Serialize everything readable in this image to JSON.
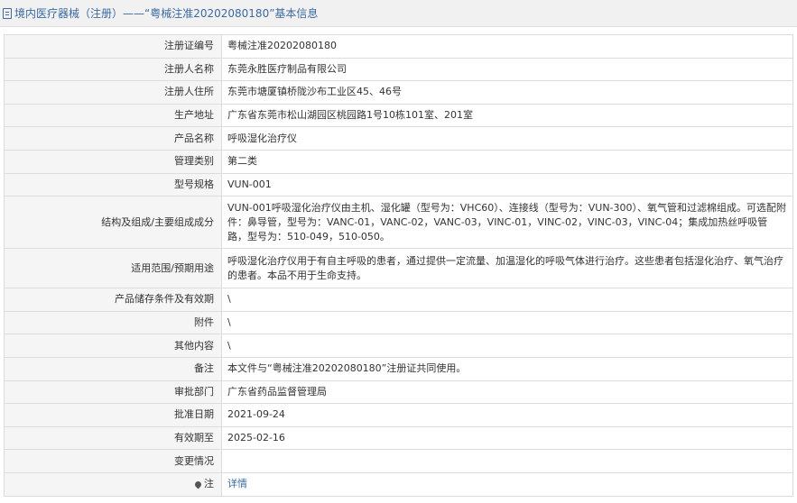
{
  "header": {
    "title": "境内医疗器械（注册）——“粤械注准20202080180”基本信息"
  },
  "rows": [
    {
      "label": "注册证编号",
      "value": "粤械注准20202080180"
    },
    {
      "label": "注册人名称",
      "value": "东莞永胜医疗制品有限公司"
    },
    {
      "label": "注册人住所",
      "value": "东莞市塘厦镇桥陇沙布工业区45、46号"
    },
    {
      "label": "生产地址",
      "value": "广东省东莞市松山湖园区桃园路1号10栋101室、201室"
    },
    {
      "label": "产品名称",
      "value": "呼吸湿化治疗仪"
    },
    {
      "label": "管理类别",
      "value": "第二类"
    },
    {
      "label": "型号规格",
      "value": "VUN-001"
    },
    {
      "label": "结构及组成/主要组成成分",
      "value": "VUN-001呼吸湿化治疗仪由主机、湿化罐（型号为：VHC60）、连接线（型号为：VUN-300）、氧气管和过滤棉组成。可选配附件：鼻导管，型号为：VANC-01，VANC-02，VANC-03，VINC-01，VINC-02，VINC-03，VINC-04；集成加热丝呼吸管路，型号为：510-049，510-050。"
    },
    {
      "label": "适用范围/预期用途",
      "value": "呼吸湿化治疗仪用于有自主呼吸的患者，通过提供一定流量、加温湿化的呼吸气体进行治疗。这些患者包括湿化治疗、氧气治疗的患者。本品不用于生命支持。"
    },
    {
      "label": "产品储存条件及有效期",
      "value": "\\"
    },
    {
      "label": "附件",
      "value": "\\"
    },
    {
      "label": "其他内容",
      "value": "\\"
    },
    {
      "label": "备注",
      "value": "本文件与“粤械注准20202080180”注册证共同使用。"
    },
    {
      "label": "审批部门",
      "value": "广东省药品监督管理局"
    },
    {
      "label": "批准日期",
      "value": "2021-09-24"
    },
    {
      "label": "有效期至",
      "value": "2025-02-16"
    },
    {
      "label": "变更情况",
      "value": ""
    }
  ],
  "note": {
    "label": "注",
    "link_text": "详情",
    "icon": "map-pin-icon"
  },
  "colors": {
    "accent": "#3a6aa0",
    "label_bg": "#f5f5f5",
    "border": "#dcdcdc"
  }
}
